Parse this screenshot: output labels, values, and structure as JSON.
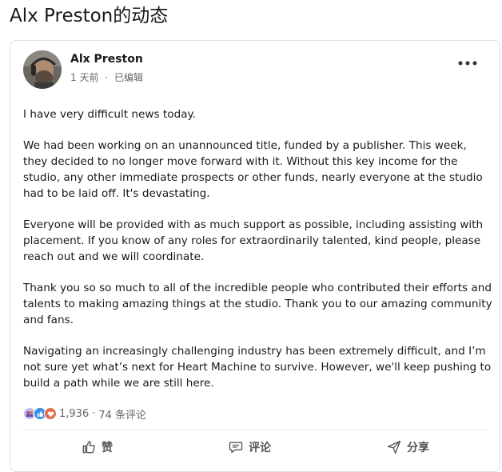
{
  "page": {
    "title": "Alx Preston的动态"
  },
  "post": {
    "author": "Alx Preston",
    "time": "1 天前",
    "dot": "·",
    "edited": "已编辑",
    "paragraphs": [
      "I have very difficult news today.",
      "We had been working on an unannounced title, funded by a publisher. This week, they decided to no longer move forward with it. Without this key income for the studio, any other immediate prospects or other funds, nearly everyone at the studio had to be laid off. It's devastating.",
      "Everyone will be provided with as much support as possible, including assisting with placement. If you know of any roles for extraordinarily talented, kind people, please reach out and we will coordinate.",
      "Thank you so so much to all of the incredible people who contributed their efforts and talents to making amazing things at the studio. Thank you to our amazing community and fans.",
      "Navigating an increasingly challenging industry has been extremely difficult, and I’m not sure yet what’s next for Heart Machine to survive. However, we'll keep pushing to build a path while we are still here."
    ]
  },
  "stats": {
    "reaction_count": "1,936",
    "separator": "·",
    "comments": "74 条评论",
    "reaction_icons": [
      "support-icon",
      "like-icon",
      "love-icon"
    ]
  },
  "actions": {
    "like": "赞",
    "comment": "评论",
    "share": "分享"
  },
  "colors": {
    "like_blue": "#378fe9",
    "love_red": "#df704d",
    "text": "#191919",
    "muted": "#666666"
  }
}
